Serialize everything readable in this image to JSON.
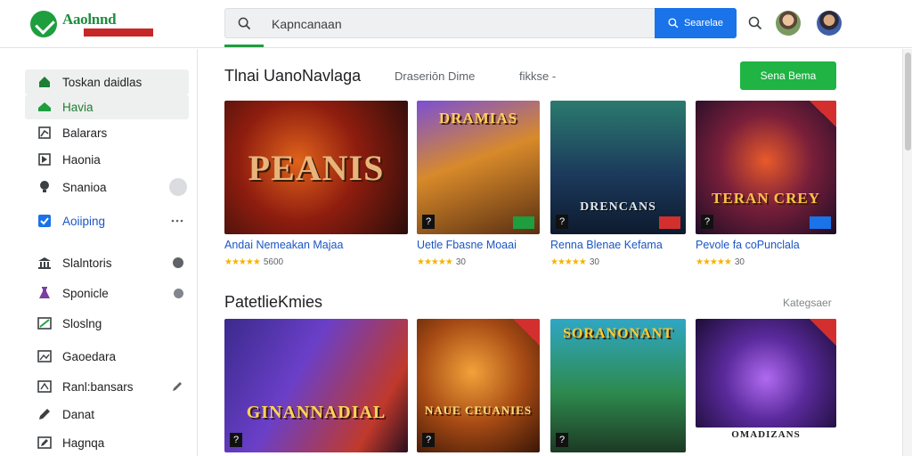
{
  "header": {
    "logo_text": "Aaolnnd",
    "logo_sub": "",
    "search_placeholder": "Kapncanaan",
    "search_button": "Searelae"
  },
  "sidebar": {
    "items": [
      {
        "label": "Toskan daidlas",
        "icon": "home-icon"
      },
      {
        "label": "Havia",
        "icon": "home-icon"
      },
      {
        "label": "Balarars",
        "icon": "chart-icon"
      },
      {
        "label": "Haonia",
        "icon": "flag-icon"
      },
      {
        "label": "Snanioa",
        "icon": "bulb-icon"
      },
      {
        "label": "Aoiiping",
        "icon": "checkbox-icon"
      },
      {
        "label": "Slalntoris",
        "icon": "building-icon"
      },
      {
        "label": "Sponicle",
        "icon": "lab-icon"
      },
      {
        "label": "Sloslng",
        "icon": "chart-line-icon"
      },
      {
        "label": "Gaoedara",
        "icon": "image-icon"
      },
      {
        "label": "Ranl:bansars",
        "icon": "image-icon"
      },
      {
        "label": "Danat",
        "icon": "pen-icon"
      },
      {
        "label": "Hagnqa",
        "icon": "pen-icon"
      }
    ]
  },
  "main": {
    "section1": {
      "title": "Tlnai UanoNavlaga",
      "tabs": [
        "Draseriōn Dime",
        "fikkse -"
      ],
      "cta": "Sena Bema",
      "cards": [
        {
          "word": "PEANIS",
          "title": "Andai Nemeakan Majaa",
          "rating": "5600"
        },
        {
          "word": "DRAMIAS",
          "title": "Uetle Fbasne Moaai",
          "rating": "30"
        },
        {
          "word": "DRENCANS",
          "title": "Renna Blenae Kefama",
          "rating": "30"
        },
        {
          "word": "TERAN CREY",
          "title": "Pevole fa coPunclala",
          "rating": "30"
        }
      ]
    },
    "section2": {
      "title": "PatetlieKmies",
      "see_more": "Kategsaer",
      "cards": [
        {
          "word": "GINANNADIAL"
        },
        {
          "word": "NAUE CEUANIES"
        },
        {
          "word": "SORANONANT"
        },
        {
          "word": "OMADIZANS"
        }
      ]
    }
  },
  "colors": {
    "brand_green": "#1e9e3e",
    "link_blue": "#1a56c4",
    "search_button_blue": "#1a73e8",
    "star": "#f4b400"
  }
}
